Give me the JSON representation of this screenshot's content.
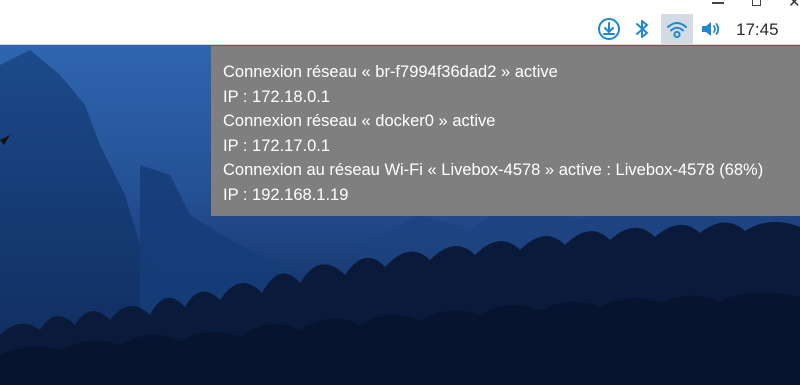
{
  "panel": {
    "clock": "17:45",
    "tray_icons": [
      "download-icon",
      "bluetooth-icon",
      "wifi-icon",
      "volume-icon"
    ],
    "accent_color": "#1e88d2"
  },
  "tooltip": {
    "lines": [
      "Connexion réseau « br-f7994f36dad2 » active",
      "IP : 172.18.0.1",
      "Connexion réseau « docker0 » active",
      "IP : 172.17.0.1",
      "Connexion au réseau Wi-Fi « Livebox-4578 » active : Livebox-4578 (68%)",
      "IP : 192.168.1.19"
    ]
  }
}
